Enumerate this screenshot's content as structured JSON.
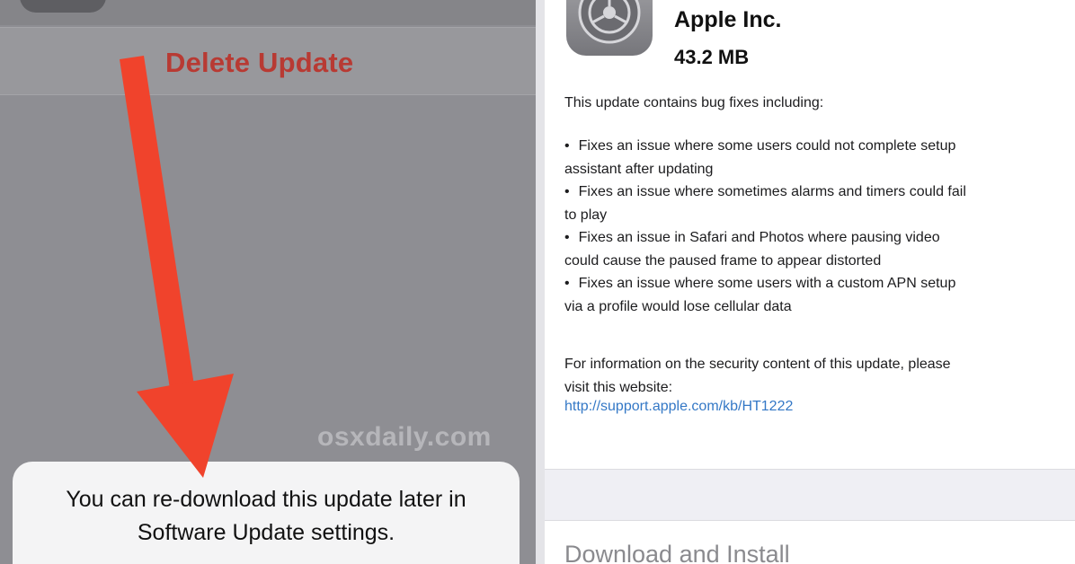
{
  "left_screen": {
    "delete_button_label": "Delete Update",
    "watermark": "osxdaily.com",
    "alert": {
      "line1": "You can re-download this update later in",
      "line2": "Software Update settings."
    },
    "annotation": "red-arrow-pointing-down"
  },
  "right_screen": {
    "app_icon": "settings-gear-icon",
    "publisher": "Apple Inc.",
    "size": "43.2 MB",
    "intro": "This update contains bug fixes including:",
    "fixes": [
      {
        "line1": "Fixes an issue where some users could not complete setup",
        "line2": "assistant after updating"
      },
      {
        "line1": "Fixes an issue where sometimes alarms and timers could fail",
        "line2": "to play"
      },
      {
        "line1": "Fixes an issue in Safari and Photos where pausing video",
        "line2": "could cause the paused frame to appear distorted"
      },
      {
        "line1": "Fixes an issue where some users with a custom APN setup",
        "line2": "via a profile would lose cellular data"
      }
    ],
    "security": {
      "line1": "For information on the security content of this update, please",
      "line2": "visit this website:"
    },
    "link": "http://support.apple.com/kb/HT1222",
    "download_button_label": "Download and Install"
  },
  "colors": {
    "destructive_red": "#b83a33",
    "link_blue": "#3478c6",
    "arrow_red": "#f0432c",
    "dimmed_overlay": "#8e8e93"
  }
}
